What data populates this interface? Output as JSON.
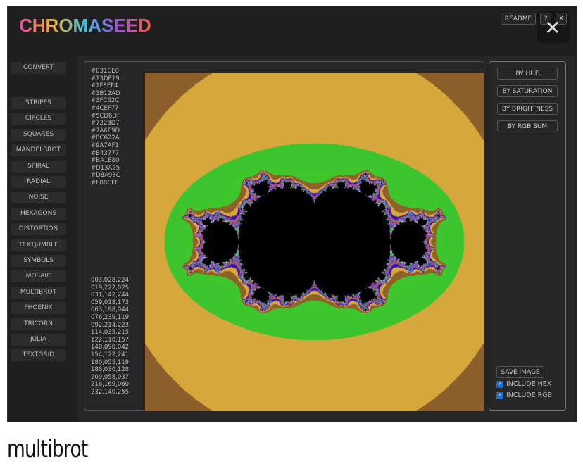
{
  "app": {
    "logo": "CHROMASEED"
  },
  "header": {
    "readme": "README",
    "help": "?",
    "close": "X"
  },
  "sidebar": {
    "convert": "CONVERT",
    "items": [
      "STRIPES",
      "CIRCLES",
      "SQUARES",
      "MANDELBROT",
      "SPIRAL",
      "RADIAL",
      "NOISE",
      "HEXAGONS",
      "DISTORTION",
      "TEXTJUMBLE",
      "SYMBOLS",
      "MOSAIC",
      "MULTIBROT",
      "PHOENIX",
      "TRICORN",
      "JULIA",
      "TEXTGRID"
    ]
  },
  "palette": {
    "hex": [
      "#031CE0",
      "#13DE19",
      "#1F8EF4",
      "#3B12AD",
      "#3FC62C",
      "#4CEF77",
      "#5CD6DF",
      "#7223D7",
      "#7A6E9D",
      "#8C622A",
      "#9A7AF1",
      "#B43777",
      "#BA1E80",
      "#D13A25",
      "#D8A93C",
      "#E88CFF"
    ],
    "rgb": [
      "003,028,224",
      "019,222,025",
      "031,142,244",
      "059,018,173",
      "063,198,044",
      "076,239,119",
      "092,214,223",
      "114,035,215",
      "122,110,157",
      "140,098,042",
      "154,122,241",
      "180,055,119",
      "186,030,128",
      "209,058,037",
      "216,169,060",
      "232,140,255"
    ]
  },
  "sort": {
    "hue": "BY HUE",
    "saturation": "BY SATURATION",
    "brightness": "BY BRIGHTNESS",
    "rgb_sum": "BY RGB SUM"
  },
  "save": {
    "label": "SAVE IMAGE",
    "include_hex": "INCLUDE HEX",
    "include_rgb": "INCLUDE RGB",
    "include_hex_checked": true,
    "include_rgb_checked": true
  },
  "caption": "multibrot"
}
